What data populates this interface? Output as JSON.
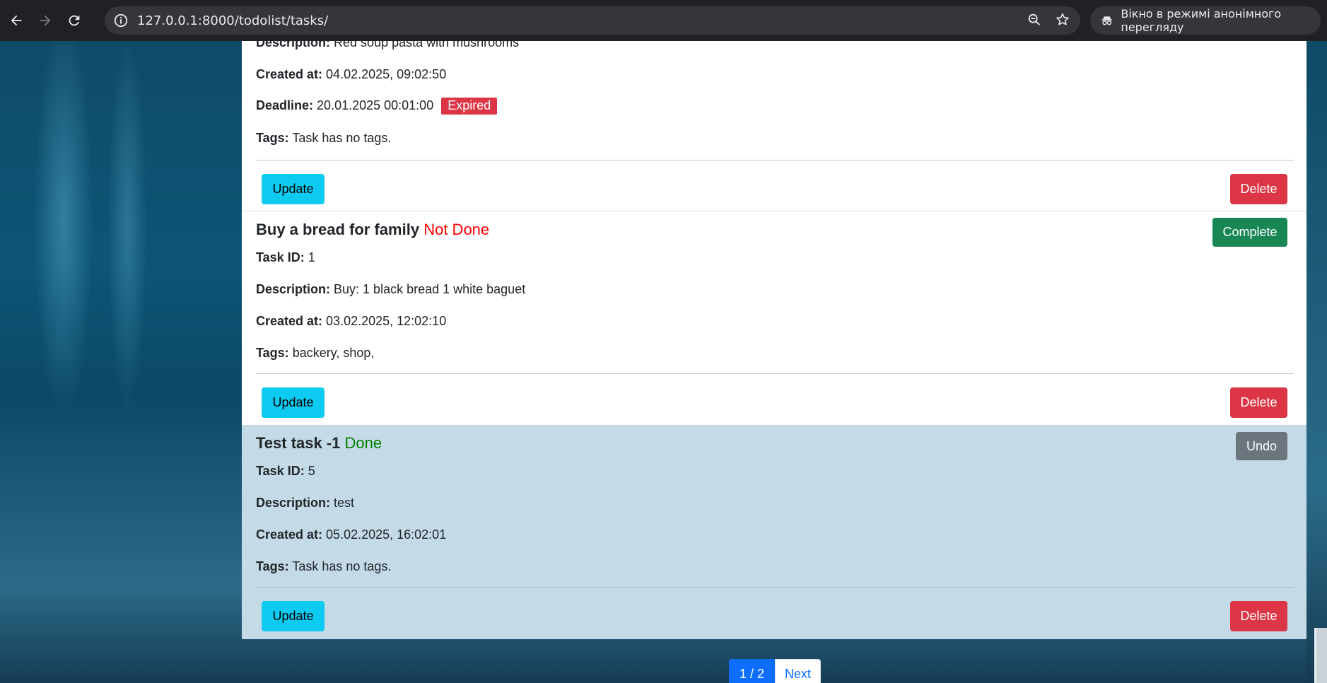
{
  "browser": {
    "url": "127.0.0.1:8000/todolist/tasks/",
    "incognito_label": "Вікно в режимі анонімного перегляду"
  },
  "labels": {
    "task_id": "Task ID:",
    "description": "Description:",
    "created_at": "Created at:",
    "deadline": "Deadline:",
    "tags": "Tags:",
    "update": "Update",
    "delete": "Delete",
    "complete": "Complete",
    "undo": "Undo",
    "expired": "Expired"
  },
  "tasks": [
    {
      "description": "Red soup pasta with mushrooms",
      "created_at": "04.02.2025, 09:02:50",
      "deadline": "20.01.2025 00:01:00",
      "tags": "Task has no tags."
    },
    {
      "title": "Buy a bread for family",
      "status": "Not Done",
      "id": "1",
      "description": "Buy: 1 black bread 1 white baguet",
      "created_at": "03.02.2025, 12:02:10",
      "tags": "backery, shop,"
    },
    {
      "title": "Test task -1",
      "status": "Done",
      "id": "5",
      "description": "test",
      "created_at": "05.02.2025, 16:02:01",
      "tags": "Task has no tags."
    }
  ],
  "pagination": {
    "current": "1 / 2",
    "next": "Next"
  }
}
